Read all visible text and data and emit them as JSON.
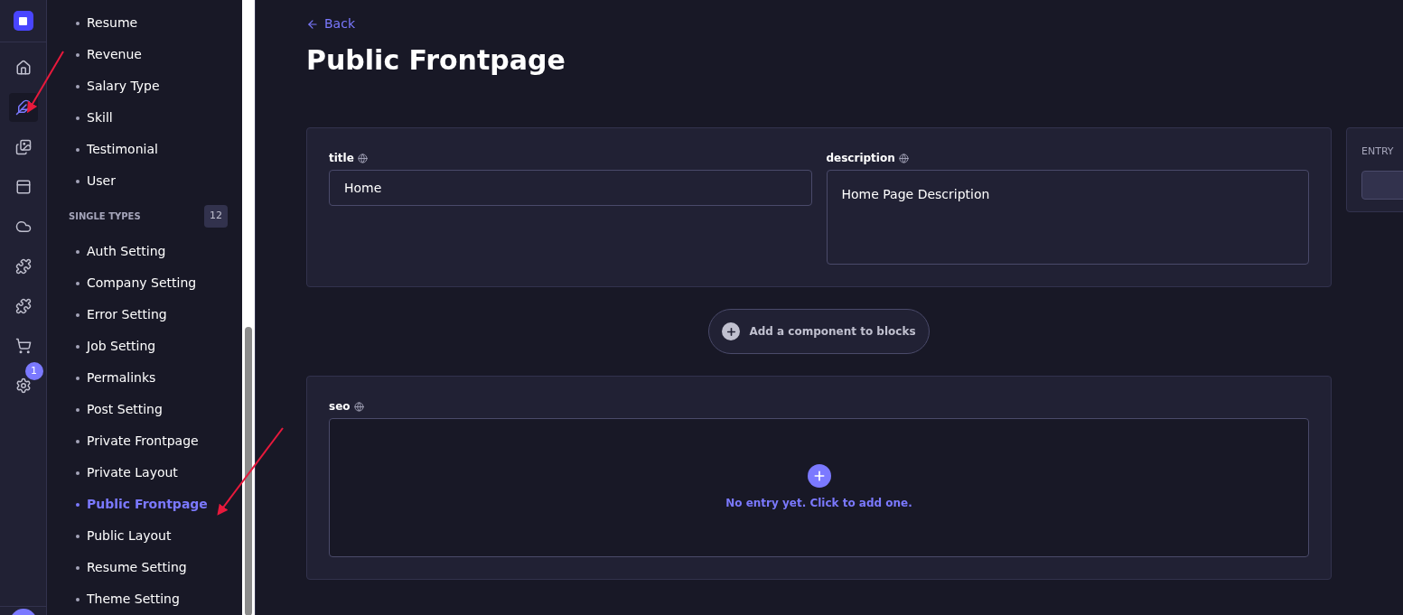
{
  "rail": [
    {
      "kind": "home",
      "selected": false
    },
    {
      "kind": "feather",
      "selected": true
    },
    {
      "kind": "media",
      "selected": false
    },
    {
      "kind": "layout",
      "selected": false
    },
    {
      "kind": "cloud",
      "selected": false
    },
    {
      "kind": "puzzle",
      "selected": false
    },
    {
      "kind": "puzzle",
      "selected": false
    },
    {
      "kind": "cart",
      "selected": false
    },
    {
      "kind": "settings",
      "selected": false,
      "badge": "1"
    }
  ],
  "collection_items": [
    {
      "label": "Resume",
      "selected": false
    },
    {
      "label": "Revenue",
      "selected": false
    },
    {
      "label": "Salary Type",
      "selected": false
    },
    {
      "label": "Skill",
      "selected": false
    },
    {
      "label": "Testimonial",
      "selected": false
    },
    {
      "label": "User",
      "selected": false
    }
  ],
  "single_types": {
    "heading": "SINGLE TYPES",
    "count": "12",
    "items": [
      {
        "label": "Auth Setting",
        "selected": false
      },
      {
        "label": "Company Setting",
        "selected": false
      },
      {
        "label": "Error Setting",
        "selected": false
      },
      {
        "label": "Job Setting",
        "selected": false
      },
      {
        "label": "Permalinks",
        "selected": false
      },
      {
        "label": "Post Setting",
        "selected": false
      },
      {
        "label": "Private Frontpage",
        "selected": false
      },
      {
        "label": "Private Layout",
        "selected": false
      },
      {
        "label": "Public Frontpage",
        "selected": true
      },
      {
        "label": "Public Layout",
        "selected": false
      },
      {
        "label": "Resume Setting",
        "selected": false
      },
      {
        "label": "Theme Setting",
        "selected": false
      }
    ]
  },
  "back": "Back",
  "page_title": "Public Frontpage",
  "fields": [
    {
      "label": "title",
      "value": "Home"
    },
    {
      "label": "description",
      "value": "Home Page Description"
    }
  ],
  "add_component": "Add a component to blocks",
  "seo": {
    "label": "seo",
    "empty": "No entry yet. Click to add one."
  },
  "side_panel": {
    "heading": "ENTRY"
  }
}
